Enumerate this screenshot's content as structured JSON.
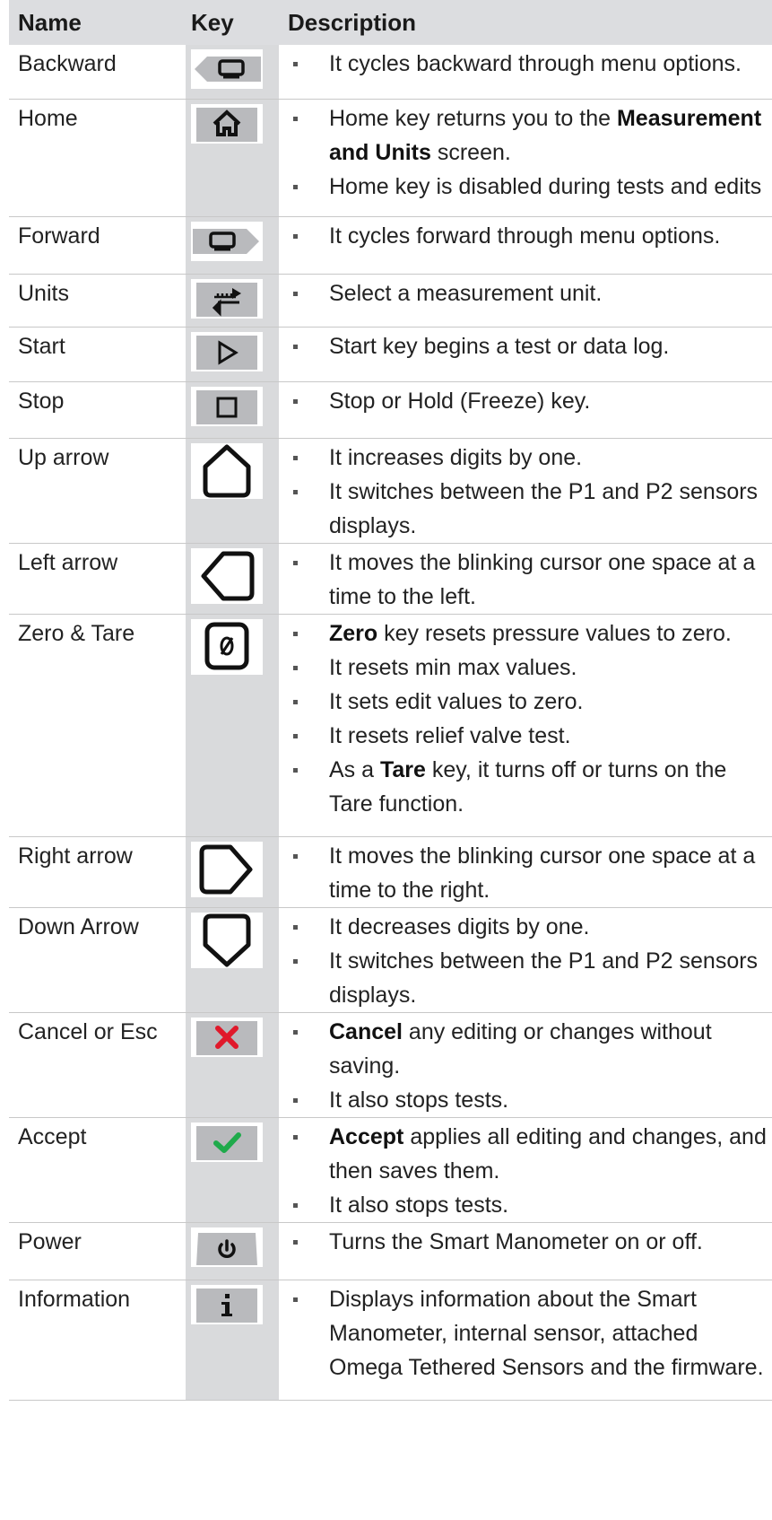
{
  "headers": {
    "name": "Name",
    "key": "Key",
    "description": "Description"
  },
  "rows": [
    {
      "name": "Backward",
      "icon": "backward-key-icon",
      "bullets": [
        {
          "pre": "It cycles backward through menu options."
        }
      ]
    },
    {
      "name": "Home",
      "icon": "home-key-icon",
      "bullets": [
        {
          "pre": "Home key returns you to the ",
          "bold": "Measurement and Units",
          "post": " screen."
        },
        {
          "pre": "Home key is disabled during tests and edits"
        }
      ]
    },
    {
      "name": "Forward",
      "icon": "forward-key-icon",
      "bullets": [
        {
          "pre": "It cycles forward through menu options."
        }
      ]
    },
    {
      "name": "Units",
      "icon": "units-key-icon",
      "bullets": [
        {
          "pre": "Select a measurement unit."
        }
      ]
    },
    {
      "name": "Start",
      "icon": "start-key-icon",
      "bullets": [
        {
          "pre": "Start key begins a test or data log."
        }
      ]
    },
    {
      "name": "Stop",
      "icon": "stop-key-icon",
      "bullets": [
        {
          "pre": "Stop or Hold (Freeze) key."
        }
      ]
    },
    {
      "name": "Up arrow",
      "icon": "up-arrow-key-icon",
      "bullets": [
        {
          "pre": "It increases digits by one."
        },
        {
          "pre": "It switches between the P1 and P2 sensors displays."
        }
      ]
    },
    {
      "name": "Left arrow",
      "icon": "left-arrow-key-icon",
      "bullets": [
        {
          "pre": "It moves the blinking cursor one space at a time to the left."
        }
      ]
    },
    {
      "name": "Zero & Tare",
      "icon": "zero-tare-key-icon",
      "bullets": [
        {
          "pre": "",
          "bold": "Zero",
          "post": " key resets pressure values to zero."
        },
        {
          "pre": "It resets min max values."
        },
        {
          "pre": "It sets edit values to zero."
        },
        {
          "pre": "It resets relief valve test."
        },
        {
          "pre": "As a ",
          "bold": "Tare",
          "post": " key, it turns off or turns on the Tare function."
        }
      ]
    },
    {
      "name": "Right arrow",
      "icon": "right-arrow-key-icon",
      "bullets": [
        {
          "pre": "It moves the blinking cursor one space at a time to the right."
        }
      ]
    },
    {
      "name": "Down Arrow",
      "icon": "down-arrow-key-icon",
      "bullets": [
        {
          "pre": "It decreases digits by one."
        },
        {
          "pre": "It switches between the P1 and P2 sensors displays."
        }
      ]
    },
    {
      "name": "Cancel or Esc",
      "icon": "cancel-key-icon",
      "bullets": [
        {
          "pre": "",
          "bold": "Cancel",
          "post": " any editing or changes without saving."
        },
        {
          "pre": "It also stops tests."
        }
      ]
    },
    {
      "name": "Accept",
      "icon": "accept-key-icon",
      "bullets": [
        {
          "pre": "",
          "bold": "Accept",
          "post": " applies all editing and changes, and then saves them."
        },
        {
          "pre": "It also stops tests."
        }
      ]
    },
    {
      "name": "Power",
      "icon": "power-key-icon",
      "bullets": [
        {
          "pre": "Turns the Smart Manometer on or off."
        }
      ]
    },
    {
      "name": "Information",
      "icon": "information-key-icon",
      "bullets": [
        {
          "pre": "Displays information about the Smart Manometer, internal sensor, attached Omega Tethered Sensors and the firmware."
        }
      ]
    }
  ],
  "colors": {
    "header_bg": "#dcdde0",
    "key_column_bg": "#d9dadc",
    "key_face": "#b9babd",
    "cancel_red": "#e0192b",
    "accept_green": "#1faa4b"
  }
}
